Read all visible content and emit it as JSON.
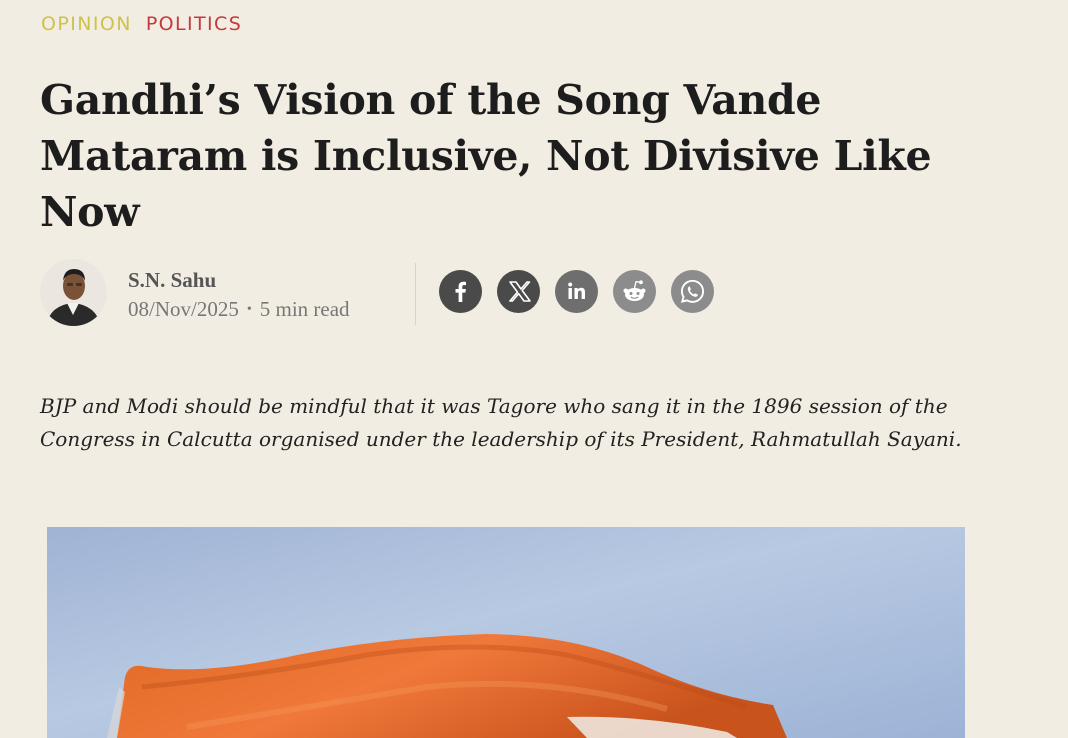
{
  "categories": {
    "opinion": "OPINION",
    "politics": "POLITICS"
  },
  "article": {
    "headline": "Gandhi’s Vision of the Song Vande Mataram is Inclusive, Not Divisive Like Now",
    "dek": "BJP and Modi should be mindful that it was Tagore who sang it in the 1896 session of the Congress in Calcutta organised under the leadership of its President, Rahmatullah Sayani."
  },
  "byline": {
    "author": "S.N. Sahu",
    "date": "08/Nov/2025",
    "separator": "•",
    "read_time": "5 min read"
  },
  "share": [
    {
      "name": "facebook",
      "icon": "facebook-icon",
      "color": "#4a4a4a"
    },
    {
      "name": "x",
      "icon": "x-icon",
      "color": "#4a4a4a"
    },
    {
      "name": "linkedin",
      "icon": "linkedin-icon",
      "color": "#6e6e6e"
    },
    {
      "name": "reddit",
      "icon": "reddit-icon",
      "color": "#8c8c8c"
    },
    {
      "name": "whatsapp",
      "icon": "whatsapp-icon",
      "color": "#8c8c8c"
    }
  ],
  "colors": {
    "background": "#f2ede3",
    "opinion": "#cfc24a",
    "politics": "#c43a3a",
    "headline": "#1d1d1d"
  }
}
